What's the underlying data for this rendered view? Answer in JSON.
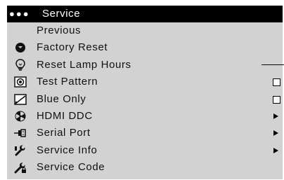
{
  "menu": {
    "title": "Service",
    "title_icon": "ellipsis-icon",
    "items": [
      {
        "label": "Previous",
        "icon": ""
      },
      {
        "label": "Factory Reset",
        "icon": "factory-reset-icon"
      },
      {
        "label": "Reset Lamp Hours",
        "icon": "lamp-icon"
      },
      {
        "label": "Test Pattern",
        "icon": "test-pattern-icon",
        "control": "checkbox"
      },
      {
        "label": "Blue Only",
        "icon": "blue-only-icon",
        "control": "checkbox"
      },
      {
        "label": "HDMI DDC",
        "icon": "hdmi-ddc-icon",
        "control": "submenu"
      },
      {
        "label": "Serial Port",
        "icon": "serial-port-icon",
        "control": "submenu"
      },
      {
        "label": "Service Info",
        "icon": "wrench-icon",
        "control": "submenu"
      },
      {
        "label": "Service Code",
        "icon": "service-code-icon"
      }
    ]
  },
  "colors": {
    "menu_background": "#d2d2d2",
    "title_background": "#000000",
    "title_text": "#ffffff",
    "item_text": "#111111"
  }
}
